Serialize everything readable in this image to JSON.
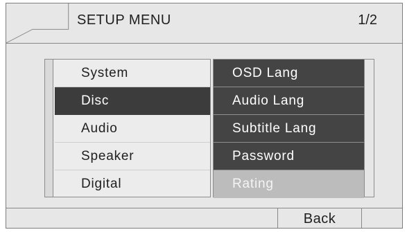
{
  "header": {
    "title": "SETUP MENU",
    "page_indicator": "1/2"
  },
  "categories": {
    "items": [
      {
        "label": "System",
        "selected": false
      },
      {
        "label": "Disc",
        "selected": true
      },
      {
        "label": "Audio",
        "selected": false
      },
      {
        "label": "Speaker",
        "selected": false
      },
      {
        "label": "Digital",
        "selected": false
      }
    ]
  },
  "options": {
    "items": [
      {
        "label": "OSD Lang",
        "highlighted": false
      },
      {
        "label": "Audio Lang",
        "highlighted": false
      },
      {
        "label": "Subtitle Lang",
        "highlighted": false
      },
      {
        "label": "Password",
        "highlighted": false
      },
      {
        "label": "Rating",
        "highlighted": true
      }
    ]
  },
  "footer": {
    "back_label": "Back"
  },
  "colors": {
    "background": "#e7e7e7",
    "selected_dark": "#3c3c3c",
    "option_dark": "#444444",
    "option_highlight": "#bcbcbc"
  }
}
